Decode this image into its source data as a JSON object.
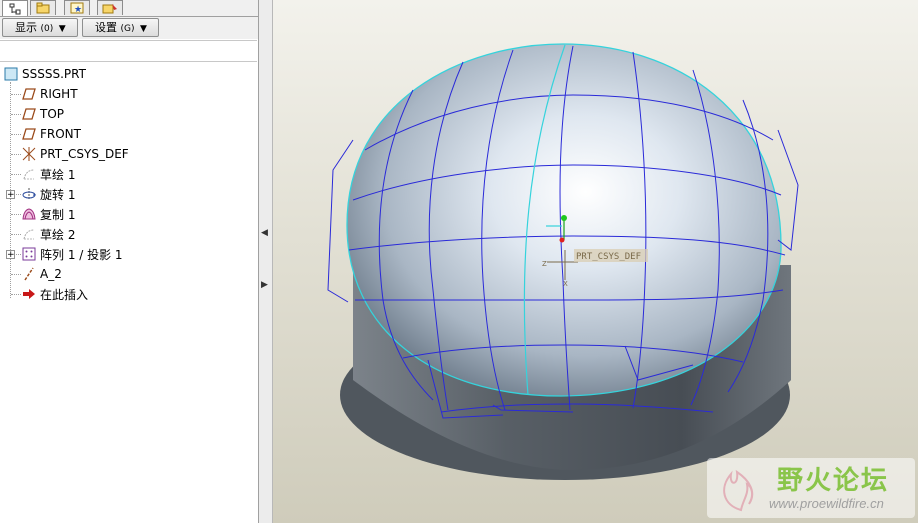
{
  "toolbar": {
    "display_label": "显示",
    "display_key": "(0)",
    "settings_label": "设置",
    "settings_key": "(G)"
  },
  "tree": {
    "items": [
      {
        "label": "SSSSS.PRT",
        "icon": "part-icon"
      },
      {
        "label": "RIGHT",
        "icon": "datum-plane-icon"
      },
      {
        "label": "TOP",
        "icon": "datum-plane-icon"
      },
      {
        "label": "FRONT",
        "icon": "datum-plane-icon"
      },
      {
        "label": "PRT_CSYS_DEF",
        "icon": "csys-icon"
      },
      {
        "label": "草绘 1",
        "icon": "sketch-icon"
      },
      {
        "label": "旋转 1",
        "icon": "revolve-icon"
      },
      {
        "label": "复制 1",
        "icon": "copy-icon"
      },
      {
        "label": "草绘 2",
        "icon": "sketch-icon"
      },
      {
        "label": "阵列 1 / 投影 1",
        "icon": "pattern-icon"
      },
      {
        "label": "A_2",
        "icon": "axis-icon"
      },
      {
        "label": "在此插入",
        "icon": "insert-here-icon"
      }
    ]
  },
  "viewport": {
    "csys_label": "PRT_CSYS_DEF",
    "axis_z": "Z",
    "axis_x": "X"
  },
  "watermark": {
    "title": "野火论坛",
    "url": "www.proewildfire.cn"
  },
  "colors": {
    "curve_blue": "#2a2ad8",
    "edge_cyan": "#35d3dc",
    "body_dark": "#4c535a",
    "dome_light": "#dfe7f0"
  }
}
